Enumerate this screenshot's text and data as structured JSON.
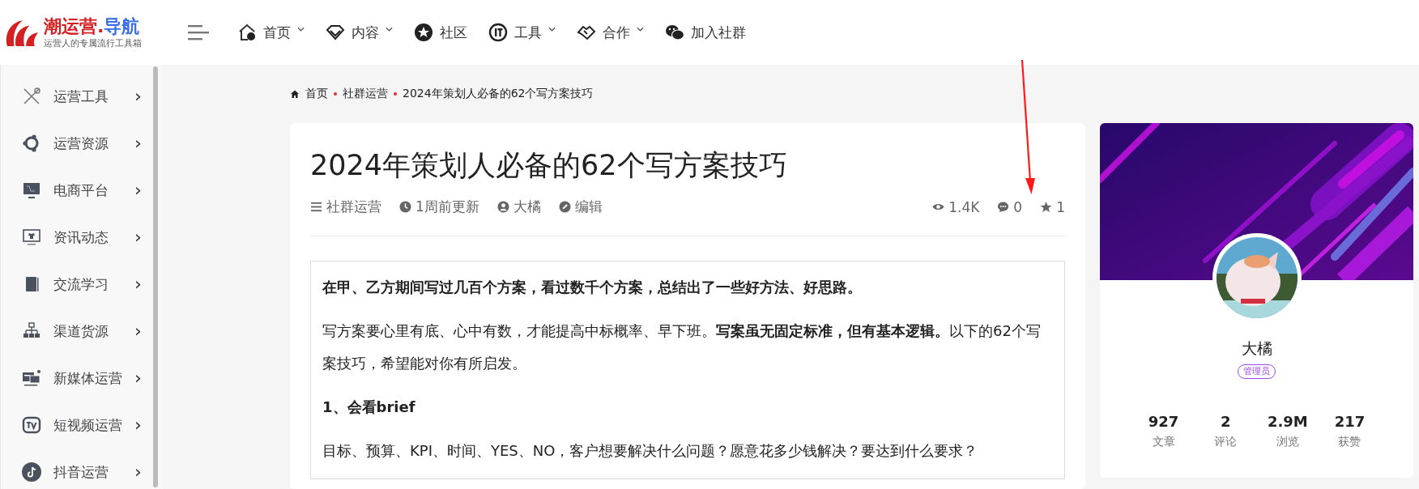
{
  "logo": {
    "name": "潮运营.",
    "accent": "导航",
    "tagline": "运营人的专属流行工具箱"
  },
  "nav": [
    {
      "label": "首页",
      "dropdown": true
    },
    {
      "label": "内容",
      "dropdown": true
    },
    {
      "label": "社区",
      "dropdown": false
    },
    {
      "label": "工具",
      "dropdown": true
    },
    {
      "label": "合作",
      "dropdown": true
    },
    {
      "label": "加入社群",
      "dropdown": false
    }
  ],
  "sidebar": {
    "items": [
      {
        "label": "运营工具"
      },
      {
        "label": "运营资源"
      },
      {
        "label": "电商平台"
      },
      {
        "label": "资讯动态"
      },
      {
        "label": "交流学习"
      },
      {
        "label": "渠道货源"
      },
      {
        "label": "新媒体运营"
      },
      {
        "label": "短视频运营"
      },
      {
        "label": "抖音运营"
      }
    ],
    "chevron": "›"
  },
  "breadcrumb": [
    "首页",
    "社群运营",
    "2024年策划人必备的62个写方案技巧"
  ],
  "article": {
    "title": "2024年策划人必备的62个写方案技巧",
    "meta": [
      "社群运营",
      "1周前更新",
      "大橘",
      "编辑"
    ],
    "stats": [
      "1.4K",
      "0",
      "1"
    ],
    "body": [
      {
        "kind": "lead",
        "text": "在甲、乙方期间写过几百个方案，看过数千个方案，总结出了一些好方法、好思路。"
      },
      {
        "kind": "text",
        "text": "写方案要心里有底、心中有数，才能提高中标概率、早下班。**写案虽无固定标准，但有基本逻辑。**以下的62个写案技巧，希望能对你有所启发。"
      },
      {
        "kind": "heading",
        "text": "1、会看brief"
      },
      {
        "kind": "text",
        "text": "目标、预算、KPI、时间、YES、NO，客户想要解决什么问题？愿意花多少钱解决？要达到什么要求？"
      }
    ]
  },
  "profile": {
    "name": "大橘",
    "role": "管理员",
    "stats": [
      {
        "value": "927",
        "label": "文章"
      },
      {
        "value": "2",
        "label": "评论"
      },
      {
        "value": "2.9M",
        "label": "浏览"
      },
      {
        "value": "217",
        "label": "获赞"
      }
    ]
  }
}
